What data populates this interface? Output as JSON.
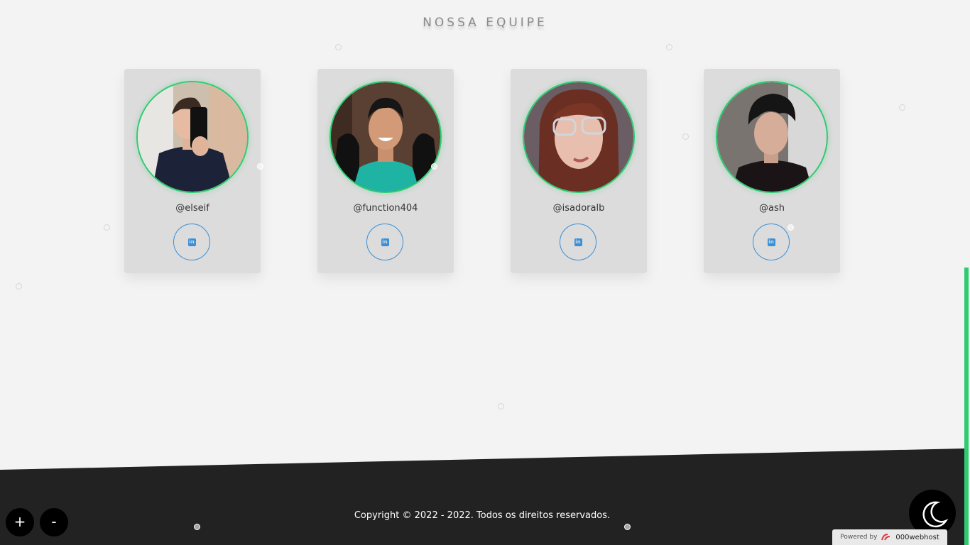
{
  "section": {
    "title": "NOSSA EQUIPE"
  },
  "team": [
    {
      "handle": "@elseif",
      "social_icon": "linkedin-icon",
      "social_label": "in"
    },
    {
      "handle": "@function404",
      "social_icon": "linkedin-icon",
      "social_label": "in"
    },
    {
      "handle": "@isadoralb",
      "social_icon": "linkedin-icon",
      "social_label": "in"
    },
    {
      "handle": "@ash",
      "social_icon": "linkedin-icon",
      "social_label": "in"
    }
  ],
  "footer": {
    "copyright": "Copyright © 2022 - 2022. Todos os direitos reservados.",
    "zoom_in_label": "+",
    "zoom_out_label": "-",
    "dark_mode_icon": "moon-icon",
    "powered_by": "Powered by",
    "host_brand": "000webhost"
  },
  "colors": {
    "accent": "#2ecc71",
    "link": "#3a8fd6",
    "footer_bg": "#222222",
    "page_bg": "#f3f3f3",
    "card_bg": "#dcdcdc"
  }
}
